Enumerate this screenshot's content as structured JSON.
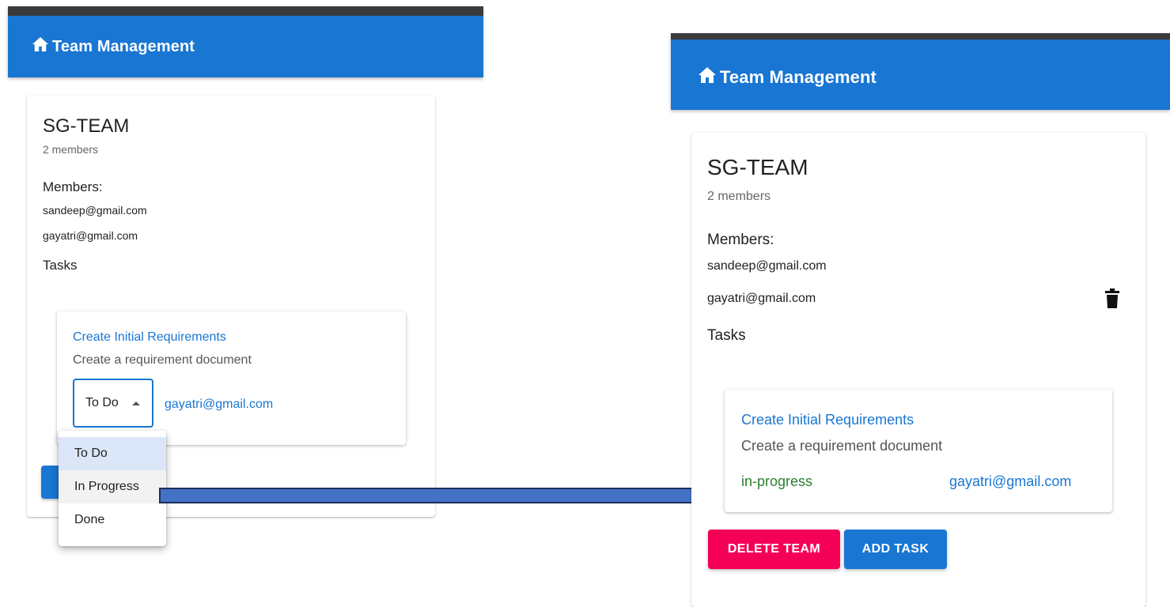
{
  "before": {
    "appbar": {
      "title": "Team Management",
      "icon": "home-icon"
    },
    "team": {
      "name": "SG-TEAM",
      "member_count": "2 members",
      "members_label": "Members:",
      "members": [
        "sandeep@gmail.com",
        "gayatri@gmail.com"
      ],
      "tasks_label": "Tasks"
    },
    "task": {
      "title": "Create Initial Requirements",
      "description": "Create a requirement document",
      "status": "To Do",
      "assignee": "gayatri@gmail.com"
    },
    "status_menu": {
      "options": [
        "To Do",
        "In Progress",
        "Done"
      ],
      "selected": "To Do",
      "hovered": "In Progress"
    }
  },
  "after": {
    "appbar": {
      "title": "Team Management",
      "icon": "home-icon"
    },
    "team": {
      "name": "SG-TEAM",
      "member_count": "2 members",
      "members_label": "Members:",
      "members": [
        "sandeep@gmail.com",
        "gayatri@gmail.com"
      ],
      "tasks_label": "Tasks"
    },
    "task": {
      "title": "Create Initial Requirements",
      "description": "Create a requirement document",
      "status": "in-progress",
      "assignee": "gayatri@gmail.com"
    },
    "buttons": {
      "delete_team": "DELETE TEAM",
      "add_task": "ADD TASK"
    },
    "icons": {
      "remove_member": "trash-icon"
    }
  },
  "colors": {
    "appbar": "#1976d2",
    "primary": "#1976d2",
    "danger": "#f50057",
    "status_green": "#2e7d32",
    "arrow_fill": "#4472c4",
    "arrow_stroke": "#1f2f5c"
  }
}
